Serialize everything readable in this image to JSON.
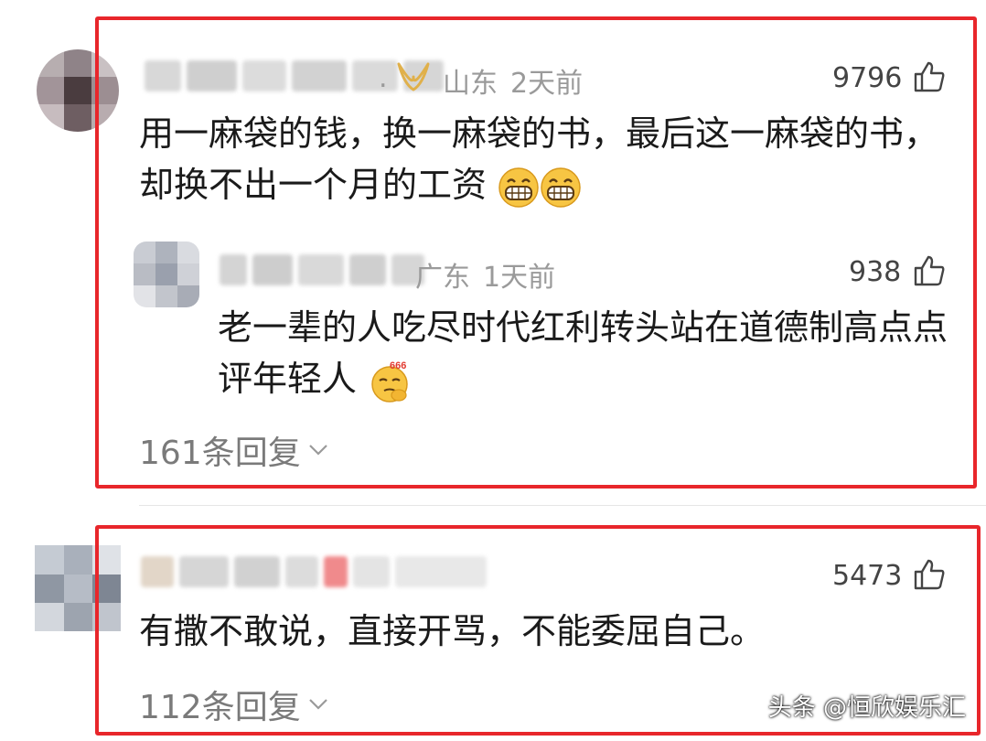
{
  "comments": [
    {
      "location": "山东",
      "time": "2天前",
      "likes": "9796",
      "text": "用一麻袋的钱，换一麻袋的书，最后这一麻袋的书，却换不出一个月的工资",
      "reply": {
        "location": "广东",
        "time": "1天前",
        "likes": "938",
        "text": "老一辈的人吃尽时代红利转头站在道德制高点点评年轻人"
      },
      "reply_count": "161条回复"
    },
    {
      "likes": "5473",
      "text": "有撒不敢说，直接开骂，不能委屈自己。",
      "reply_count": "112条回复"
    }
  ],
  "watermark": "头条 @恒欣娱乐汇",
  "colors": {
    "annotation_red": "#e8262b",
    "meta_gray": "#9a9a9a",
    "vip_gold": "#e0b04a"
  },
  "icons": {
    "like": "thumbs-up-icon",
    "vip": "vip-badge-icon",
    "chevron": "chevron-down-icon",
    "emoji_grin": "grinning-emoji",
    "emoji_666": "thinking-666-emoji"
  }
}
